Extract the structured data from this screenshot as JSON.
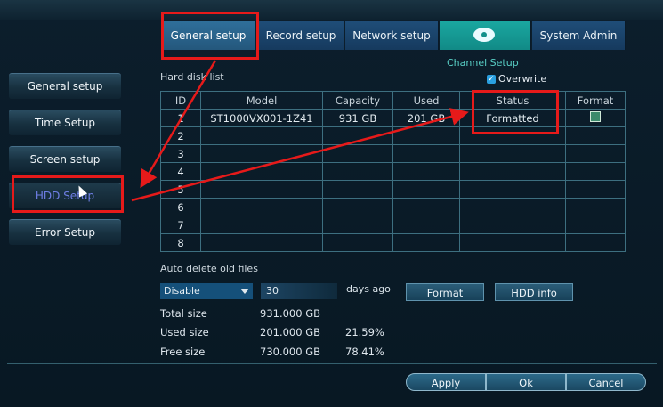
{
  "tabs": [
    {
      "label": "General setup"
    },
    {
      "label": "Record setup"
    },
    {
      "label": "Network setup"
    },
    {
      "label": ""
    },
    {
      "label": "System Admin"
    }
  ],
  "channel_setup_label": "Channel Setup",
  "sidebar": {
    "items": [
      {
        "label": "General setup"
      },
      {
        "label": "Time Setup"
      },
      {
        "label": "Screen setup"
      },
      {
        "label": "HDD Setup"
      },
      {
        "label": "Error Setup"
      }
    ]
  },
  "hdd": {
    "title": "Hard disk list",
    "overwrite_label": "Overwrite",
    "overwrite_checked": true,
    "columns": [
      "ID",
      "Model",
      "Capacity",
      "Used",
      "Status",
      "Format"
    ],
    "rows": [
      {
        "id": "1",
        "model": "ST1000VX001-1Z41",
        "capacity": "931 GB",
        "used": "201 GB",
        "status": "Formatted"
      },
      {
        "id": "2",
        "model": "",
        "capacity": "",
        "used": "",
        "status": ""
      },
      {
        "id": "3",
        "model": "",
        "capacity": "",
        "used": "",
        "status": ""
      },
      {
        "id": "4",
        "model": "",
        "capacity": "",
        "used": "",
        "status": ""
      },
      {
        "id": "5",
        "model": "",
        "capacity": "",
        "used": "",
        "status": ""
      },
      {
        "id": "6",
        "model": "",
        "capacity": "",
        "used": "",
        "status": ""
      },
      {
        "id": "7",
        "model": "",
        "capacity": "",
        "used": "",
        "status": ""
      },
      {
        "id": "8",
        "model": "",
        "capacity": "",
        "used": "",
        "status": ""
      }
    ]
  },
  "auto_delete": {
    "label": "Auto delete old files",
    "mode": "Disable",
    "days": "30",
    "days_label": "days ago"
  },
  "buttons": {
    "format": "Format",
    "hdd_info": "HDD info",
    "apply": "Apply",
    "ok": "Ok",
    "cancel": "Cancel"
  },
  "sizes": {
    "total_label": "Total size",
    "total_value": "931.000 GB",
    "used_label": "Used size",
    "used_value": "201.000 GB",
    "used_percent": "21.59%",
    "free_label": "Free size",
    "free_value": "730.000 GB",
    "free_percent": "78.41%"
  },
  "colors": {
    "annotation_red": "#e61a1a",
    "tab_active": "#2f6f9a",
    "channel_tab": "#1aa7a0"
  }
}
